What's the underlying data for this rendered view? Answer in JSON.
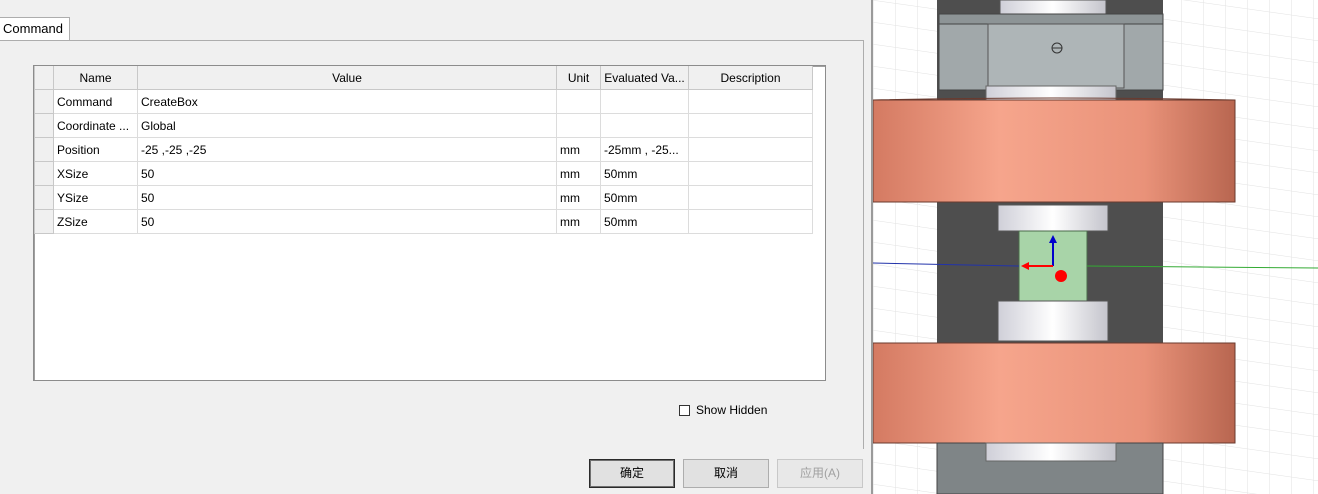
{
  "dialog": {
    "tab_label": "Command",
    "columns": [
      "Name",
      "Value",
      "Unit",
      "Evaluated Va...",
      "Description"
    ],
    "rows": [
      {
        "name": "Command",
        "value": "CreateBox",
        "unit": "",
        "evaluated": "",
        "description": ""
      },
      {
        "name": "Coordinate ...",
        "value": "Global",
        "unit": "",
        "evaluated": "",
        "description": ""
      },
      {
        "name": "Position",
        "value": "-25 ,-25 ,-25",
        "unit": "mm",
        "evaluated": "-25mm , -25...",
        "description": ""
      },
      {
        "name": "XSize",
        "value": "50",
        "unit": "mm",
        "evaluated": "50mm",
        "description": ""
      },
      {
        "name": "YSize",
        "value": "50",
        "unit": "mm",
        "evaluated": "50mm",
        "description": ""
      },
      {
        "name": "ZSize",
        "value": "50",
        "unit": "mm",
        "evaluated": "50mm",
        "description": ""
      }
    ],
    "show_hidden_label": "Show Hidden",
    "show_hidden_checked": false,
    "buttons": {
      "ok": "确定",
      "cancel": "取消",
      "apply": "应用(A)"
    }
  },
  "viewport": {
    "axis_colors": {
      "x": "#ff0000",
      "y": "#0000cc",
      "z": "#00aa00"
    },
    "colors": {
      "copper": "#e8907a",
      "frame": "#9ca3a5",
      "dark_block": "#505050",
      "selected_box": "#a8d4a8",
      "grid": "#dcdcdc"
    }
  }
}
